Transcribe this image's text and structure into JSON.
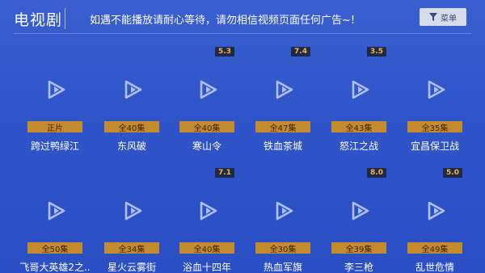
{
  "header": {
    "title": "电视剧",
    "notice": "如遇不能播放请耐心等待，请勿相信视频页面任何广告~!",
    "menu_label": "菜单"
  },
  "icons": {
    "menu": "filter-icon",
    "play": "play-icon"
  },
  "colors": {
    "background": "#2f55c9",
    "episode_badge": "#c48a2e",
    "score_text": "#ffb13b",
    "score_bg": "#1d2a4a"
  },
  "shows": [
    {
      "name": "跨过鸭绿江",
      "episodes": "正片",
      "score": ""
    },
    {
      "name": "东风破",
      "episodes": "全40集",
      "score": ""
    },
    {
      "name": "寒山令",
      "episodes": "全40集",
      "score": "5.3"
    },
    {
      "name": "铁血茶城",
      "episodes": "全47集",
      "score": "7.4"
    },
    {
      "name": "怒江之战",
      "episodes": "全43集",
      "score": "3.5"
    },
    {
      "name": "宜昌保卫战",
      "episodes": "全35集",
      "score": ""
    },
    {
      "name": "飞哥大英雄2之..",
      "episodes": "全50集",
      "score": ""
    },
    {
      "name": "星火云雾街",
      "episodes": "全34集",
      "score": ""
    },
    {
      "name": "浴血十四年",
      "episodes": "全40集",
      "score": "7.1"
    },
    {
      "name": "热血军旗",
      "episodes": "全30集",
      "score": ""
    },
    {
      "name": "李三枪",
      "episodes": "全39集",
      "score": "8.0"
    },
    {
      "name": "乱世危情",
      "episodes": "全49集",
      "score": "5.0"
    }
  ]
}
